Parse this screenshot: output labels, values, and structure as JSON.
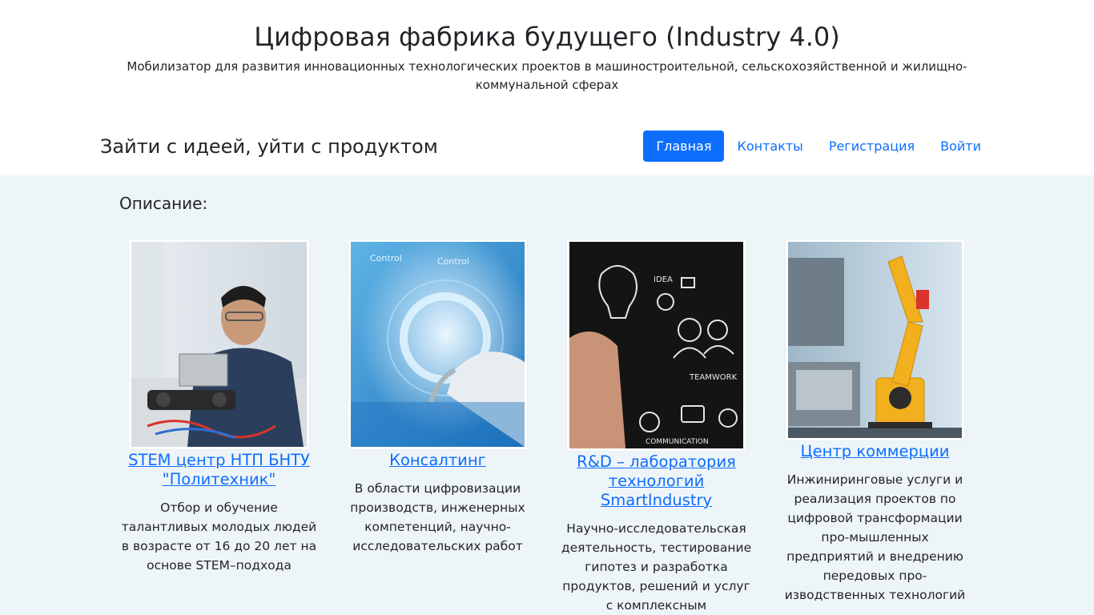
{
  "header": {
    "title": "Цифровая фабрика будущего (Industry 4.0)",
    "subtitle": "Мобилизатор для развития инновационных технологических проектов в машиностроительной, сельскохозяйственной и жилищно-коммунальной сферах"
  },
  "navbar": {
    "brand": "Зайти с идеей, уйти с продуктом",
    "items": [
      {
        "label": "Главная",
        "active": true
      },
      {
        "label": "Контакты",
        "active": false
      },
      {
        "label": "Регистрация",
        "active": false
      },
      {
        "label": "Войти",
        "active": false
      }
    ]
  },
  "main": {
    "section_title": "Описание:",
    "cards": [
      {
        "title": "STEM центр НТП БНТУ \"Политехник\"",
        "text": "Отбор и обучение талантливых молодых людей в возрасте от 16 до 20 лет на основе STEM–подхода"
      },
      {
        "title": "Консалтинг",
        "text": "В области цифровизации производств, инженерных компетенций, научно-исследовательских работ"
      },
      {
        "title": "R&D – лаборатория технологий SmartIndustry",
        "text": "Научно-исследовательская деятельность, тестирование гипотез и разработка продуктов, решений и услуг с комплексным"
      },
      {
        "title": "Центр коммерции",
        "text": "Инжиниринговые услуги и реализация проектов по цифровой трансформации про-мышленных предприятий и внедрению передовых про-изводственных технологий"
      }
    ],
    "photo_labels": {
      "control_1": "Control",
      "control_2": "Control",
      "idea": "IDEA",
      "teamwork": "TEAMWORK",
      "communication": "COMMUNICATION"
    }
  },
  "colors": {
    "primary": "#0d6efd",
    "content_bg": "#eef5f8",
    "text": "#212529"
  }
}
